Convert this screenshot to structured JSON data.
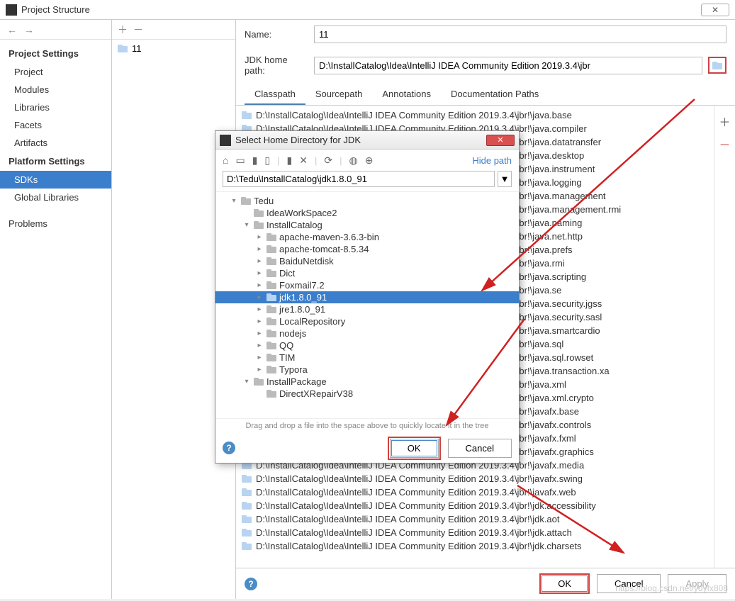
{
  "window": {
    "title": "Project Structure"
  },
  "settings": {
    "projectHeader": "Project Settings",
    "project": "Project",
    "modules": "Modules",
    "libraries": "Libraries",
    "facets": "Facets",
    "artifacts": "Artifacts",
    "platformHeader": "Platform Settings",
    "sdks": "SDKs",
    "globalLibs": "Global Libraries",
    "problems": "Problems"
  },
  "sdkList": {
    "items": [
      "11"
    ]
  },
  "form": {
    "nameLabel": "Name:",
    "nameValue": "11",
    "pathLabel": "JDK home path:",
    "pathValue": "D:\\InstallCatalog\\Idea\\IntelliJ IDEA Community Edition 2019.3.4\\jbr"
  },
  "tabs": {
    "classpath": "Classpath",
    "sourcepath": "Sourcepath",
    "annotations": "Annotations",
    "docpaths": "Documentation Paths"
  },
  "classpath": {
    "prefix": "D:\\InstallCatalog\\Idea\\IntelliJ IDEA Community Edition 2019.3.4\\jbr!\\",
    "items": [
      "java.base",
      "java.compiler",
      "java.datatransfer",
      "java.desktop",
      "java.instrument",
      "java.logging",
      "java.management",
      "java.management.rmi",
      "java.naming",
      "java.net.http",
      "java.prefs",
      "java.rmi",
      "java.scripting",
      "java.se",
      "java.security.jgss",
      "java.security.sasl",
      "java.smartcardio",
      "java.sql",
      "java.sql.rowset",
      "java.transaction.xa",
      "java.xml",
      "java.xml.crypto",
      "javafx.base",
      "javafx.controls",
      "javafx.fxml",
      "javafx.graphics",
      "javafx.media",
      "javafx.swing",
      "javafx.web",
      "jdk.accessibility",
      "jdk.aot",
      "jdk.attach",
      "jdk.charsets"
    ]
  },
  "modal": {
    "title": "Select Home Directory for JDK",
    "hidePath": "Hide path",
    "pathValue": "D:\\Tedu\\InstallCatalog\\jdk1.8.0_91",
    "tree": {
      "root": "Tedu",
      "ideaws": "IdeaWorkSpace2",
      "installcatalog": "InstallCatalog",
      "items": [
        "apache-maven-3.6.3-bin",
        "apache-tomcat-8.5.34",
        "BaiduNetdisk",
        "Dict",
        "Foxmail7.2",
        "jdk1.8.0_91",
        "jre1.8.0_91",
        "LocalRepository",
        "nodejs",
        "QQ",
        "TIM",
        "Typora"
      ],
      "installpackage": "InstallPackage",
      "subpkg": "DirectXRepairV38"
    },
    "helpText": "Drag and drop a file into the space above to quickly locate it in the tree",
    "ok": "OK",
    "cancel": "Cancel"
  },
  "buttons": {
    "ok": "OK",
    "cancel": "Cancel",
    "apply": "Apply"
  },
  "watermark": "https://blog.csdn.net/ydyfx808"
}
